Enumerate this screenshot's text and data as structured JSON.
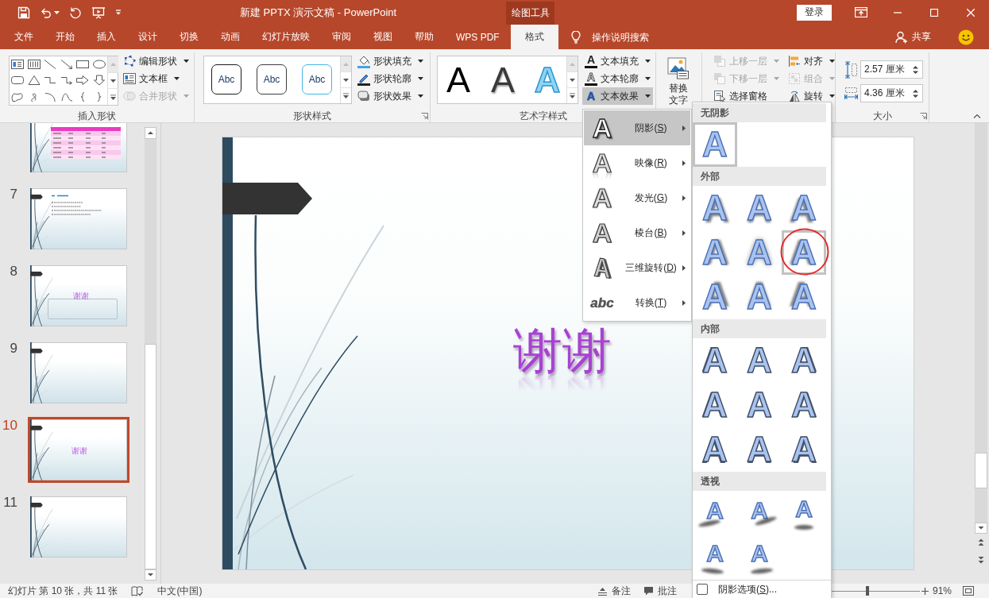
{
  "window": {
    "title": "新建 PPTX 演示文稿 - PowerPoint",
    "context_label": "绘图工具",
    "sign_in": "登录"
  },
  "tabs": [
    {
      "label": "文件",
      "selected": false
    },
    {
      "label": "开始",
      "selected": false
    },
    {
      "label": "插入",
      "selected": false
    },
    {
      "label": "设计",
      "selected": false
    },
    {
      "label": "切换",
      "selected": false
    },
    {
      "label": "动画",
      "selected": false
    },
    {
      "label": "幻灯片放映",
      "selected": false
    },
    {
      "label": "审阅",
      "selected": false
    },
    {
      "label": "视图",
      "selected": false
    },
    {
      "label": "帮助",
      "selected": false
    },
    {
      "label": "WPS PDF",
      "selected": false
    },
    {
      "label": "格式",
      "selected": true
    }
  ],
  "tell_me": {
    "placeholder": "操作说明搜索"
  },
  "share": "共享",
  "ribbon": {
    "insert_shapes": {
      "label": "插入形状",
      "commands": [
        {
          "kind": "edit-shape",
          "label": "编辑形状",
          "dropdown": true,
          "disabled": false
        },
        {
          "kind": "text-box",
          "label": "文本框",
          "dropdown": true,
          "disabled": false
        },
        {
          "kind": "merge-shapes",
          "label": "合并形状",
          "dropdown": true,
          "disabled": true
        }
      ]
    },
    "shape_styles": {
      "label": "形状样式",
      "presets": [
        {
          "text": "Abc",
          "color": "#1a1a1a"
        },
        {
          "text": "Abc",
          "color": "#3c3c3c"
        },
        {
          "text": "Abc",
          "color": "#41b6e6"
        }
      ],
      "commands": [
        {
          "kind": "shape-fill",
          "label": "形状填充",
          "dropdown": true,
          "disabled": false
        },
        {
          "kind": "shape-outline",
          "label": "形状轮廓",
          "dropdown": true,
          "disabled": false
        },
        {
          "kind": "shape-effects",
          "label": "形状效果",
          "dropdown": true,
          "disabled": false
        }
      ]
    },
    "wordart_styles": {
      "label": "艺术字样式",
      "presets": [
        {
          "glyph": "A",
          "kind": "plain"
        },
        {
          "glyph": "A",
          "kind": "shaded"
        },
        {
          "glyph": "A",
          "kind": "outline"
        }
      ],
      "commands": [
        {
          "kind": "text-fill",
          "glyph": "A",
          "label": "文本填充",
          "dropdown": true,
          "disabled": false,
          "pressed": false
        },
        {
          "kind": "text-outline",
          "glyph": "A",
          "label": "文本轮廓",
          "dropdown": true,
          "disabled": false,
          "pressed": false
        },
        {
          "kind": "text-effects",
          "glyph": "A",
          "label": "文本效果",
          "dropdown": true,
          "disabled": false,
          "pressed": true
        }
      ]
    },
    "alt_text": {
      "label": "替换文字"
    },
    "arrange": {
      "commands": [
        {
          "kind": "bring-forward",
          "label": "上移一层",
          "dropdown": true,
          "disabled": true
        },
        {
          "kind": "send-backward",
          "label": "下移一层",
          "dropdown": true,
          "disabled": true
        },
        {
          "kind": "selection-pane",
          "label": "选择窗格",
          "dropdown": false,
          "disabled": false
        },
        {
          "kind": "align",
          "label": "对齐",
          "dropdown": true,
          "disabled": false
        },
        {
          "kind": "group",
          "label": "组合",
          "dropdown": true,
          "disabled": true
        },
        {
          "kind": "rotate",
          "label": "旋转",
          "dropdown": true,
          "disabled": false
        }
      ]
    },
    "size": {
      "label": "大小",
      "fields": [
        {
          "kind": "height",
          "value": "2.57 厘米"
        },
        {
          "kind": "width",
          "value": "4.36 厘米"
        }
      ]
    }
  },
  "slides": [
    {
      "kind": "table",
      "selected": false
    },
    {
      "number": "7",
      "kind": "bullets",
      "selected": false
    },
    {
      "number": "8",
      "kind": "text-box",
      "text": "谢谢",
      "selected": false
    },
    {
      "number": "9",
      "kind": "blank",
      "selected": false
    },
    {
      "number": "10",
      "kind": "title",
      "text": "谢谢",
      "selected": true
    },
    {
      "number": "11",
      "kind": "blank",
      "selected": false
    }
  ],
  "slide": {
    "title": "谢谢"
  },
  "text_effects_menu": [
    {
      "kind": "shadow",
      "glyph": "A",
      "text": "阴影(",
      "key": "S",
      "end": ")",
      "selected": true
    },
    {
      "kind": "reflection",
      "glyph": "A",
      "text": "映像(",
      "key": "R",
      "end": ")",
      "selected": false
    },
    {
      "kind": "glow",
      "glyph": "A",
      "text": "发光(",
      "key": "G",
      "end": ")",
      "selected": false
    },
    {
      "kind": "bevel",
      "glyph": "A",
      "text": "棱台(",
      "key": "B",
      "end": ")",
      "selected": false
    },
    {
      "kind": "rotation",
      "glyph": "A",
      "text": "三维旋转(",
      "key": "D",
      "end": ")",
      "selected": false
    },
    {
      "kind": "transform",
      "glyph": "abc",
      "text": "转换(",
      "key": "T",
      "end": ")",
      "selected": false
    }
  ],
  "shadow_gallery": {
    "sections": [
      {
        "title": "无阴影",
        "kind": "none",
        "items": [
          {
            "glyph": "A",
            "selected": true,
            "circled": false
          }
        ]
      },
      {
        "title": "外部",
        "kind": "outer",
        "items": [
          {
            "glyph": "A",
            "selected": false,
            "circled": false
          },
          {
            "glyph": "A",
            "selected": false,
            "circled": false
          },
          {
            "glyph": "A",
            "selected": false,
            "circled": false
          },
          {
            "glyph": "A",
            "selected": false,
            "circled": false
          },
          {
            "glyph": "A",
            "selected": false,
            "circled": false
          },
          {
            "glyph": "A",
            "selected": true,
            "circled": true
          },
          {
            "glyph": "A",
            "selected": false,
            "circled": false
          },
          {
            "glyph": "A",
            "selected": false,
            "circled": false
          },
          {
            "glyph": "A",
            "selected": false,
            "circled": false
          }
        ]
      },
      {
        "title": "内部",
        "kind": "inner",
        "items": [
          {
            "glyph": "A",
            "selected": false,
            "circled": false
          },
          {
            "glyph": "A",
            "selected": false,
            "circled": false
          },
          {
            "glyph": "A",
            "selected": false,
            "circled": false
          },
          {
            "glyph": "A",
            "selected": false,
            "circled": false
          },
          {
            "glyph": "A",
            "selected": false,
            "circled": false
          },
          {
            "glyph": "A",
            "selected": false,
            "circled": false
          },
          {
            "glyph": "A",
            "selected": false,
            "circled": false
          },
          {
            "glyph": "A",
            "selected": false,
            "circled": false
          },
          {
            "glyph": "A",
            "selected": false,
            "circled": false
          }
        ]
      },
      {
        "title": "透视",
        "kind": "perspective",
        "items": [
          {
            "glyph": "A",
            "selected": false,
            "circled": false
          },
          {
            "glyph": "A",
            "selected": false,
            "circled": false
          },
          {
            "glyph": "A",
            "selected": false,
            "circled": false
          },
          {
            "glyph": "A",
            "selected": false,
            "circled": false
          },
          {
            "glyph": "A",
            "selected": false,
            "circled": false
          }
        ]
      }
    ],
    "options": {
      "text": "阴影选项(",
      "key": "S",
      "end": ")...",
      "checked": false
    }
  },
  "status_bar": {
    "slide_info": "幻灯片 第 10 张，共 11 张",
    "language": "中文(中国)",
    "notes": "备注",
    "comments": "批注",
    "zoom_slider": {
      "level": 0.41
    },
    "zoom": "91%"
  }
}
